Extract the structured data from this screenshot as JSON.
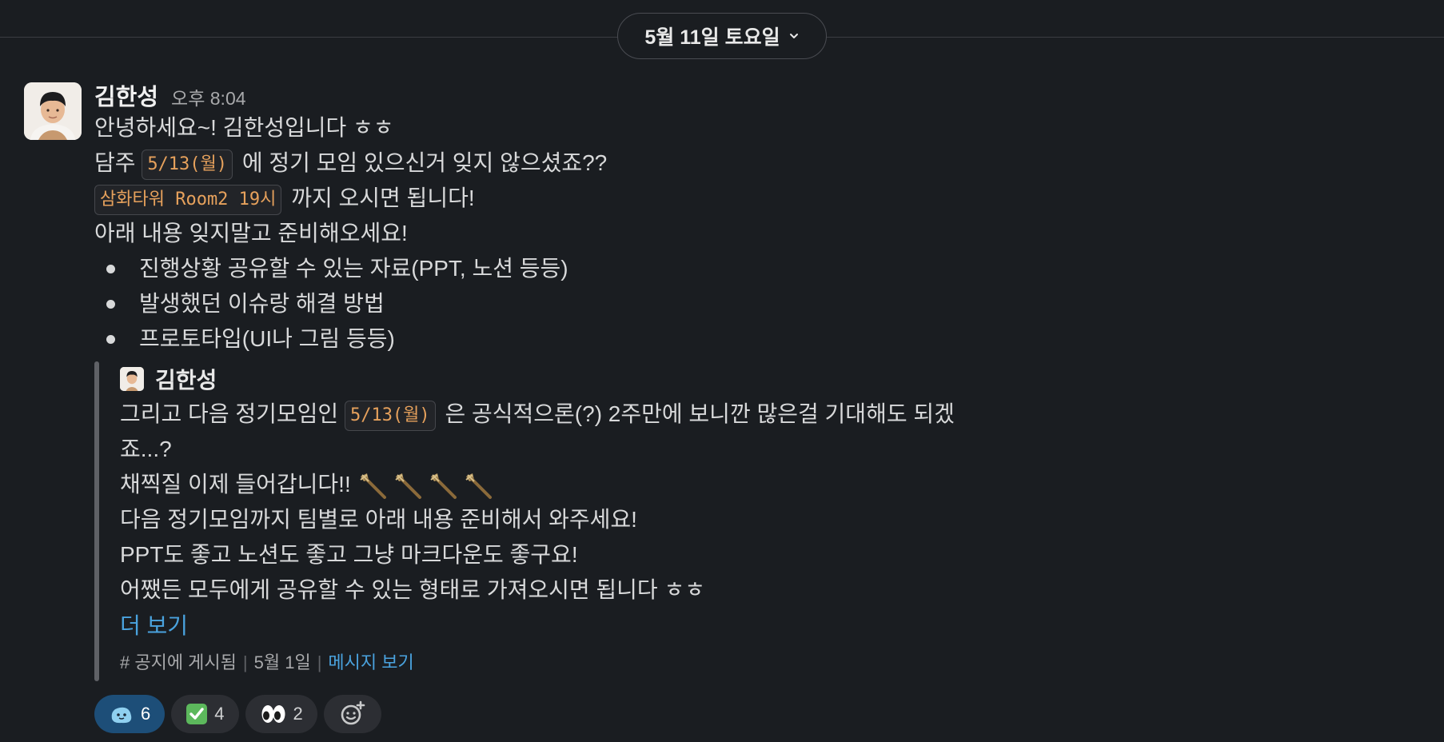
{
  "date_divider": {
    "label": "5월 11일 토요일"
  },
  "message": {
    "author": "김한성",
    "time": "오후 8:04",
    "line1": "안녕하세요~! 김한성입니다 ㅎㅎ",
    "line2_prefix": "담주",
    "line2_tag": "5/13(월)",
    "line2_suffix": "에 정기 모임 있으신거 잊지 않으셨죠??",
    "line3_tag": "삼화타워 Room2 19시",
    "line3_suffix": "까지 오시면 됩니다!",
    "line4": "아래 내용 잊지말고 준비해오세요!",
    "bullets": [
      "진행상황 공유할 수 있는 자료(PPT, 노션 등등)",
      "발생했던 이슈랑 해결 방법",
      "프로토타입(UI나 그림 등등)"
    ]
  },
  "shared": {
    "author": "김한성",
    "text1_prefix": "그리고 다음 정기모임인",
    "text1_tag": "5/13(월)",
    "text1_suffix": "은 공식적으론(?) 2주만에 보니깐 많은걸 기대해도 되겠",
    "text1_wrap": "죠...?",
    "text2": "채찍질 이제 들어갑니다!!",
    "text3": "다음 정기모임까지 팀별로 아래 내용 준비해서 와주세요!",
    "text4": "PPT도 좋고 노션도 좋고 그냥 마크다운도 좋구요!",
    "text5": "어쨌든 모두에게 공유할 수 있는 형태로 가져오시면 됩니다 ㅎㅎ",
    "more_label": "더 보기",
    "channel": "# 공지에 게시됨",
    "date": "5월 1일",
    "view_label": "메시지 보기"
  },
  "reactions": [
    {
      "emoji": "blue-blob-face",
      "count": "6",
      "active": true
    },
    {
      "emoji": "check-mark-button",
      "count": "4",
      "active": false
    },
    {
      "emoji": "eyes",
      "count": "2",
      "active": false
    }
  ],
  "colors": {
    "background": "#1a1d21",
    "code_tag": "#e6a15c",
    "link": "#4aa3df",
    "active_reaction": "#1d4e78"
  }
}
